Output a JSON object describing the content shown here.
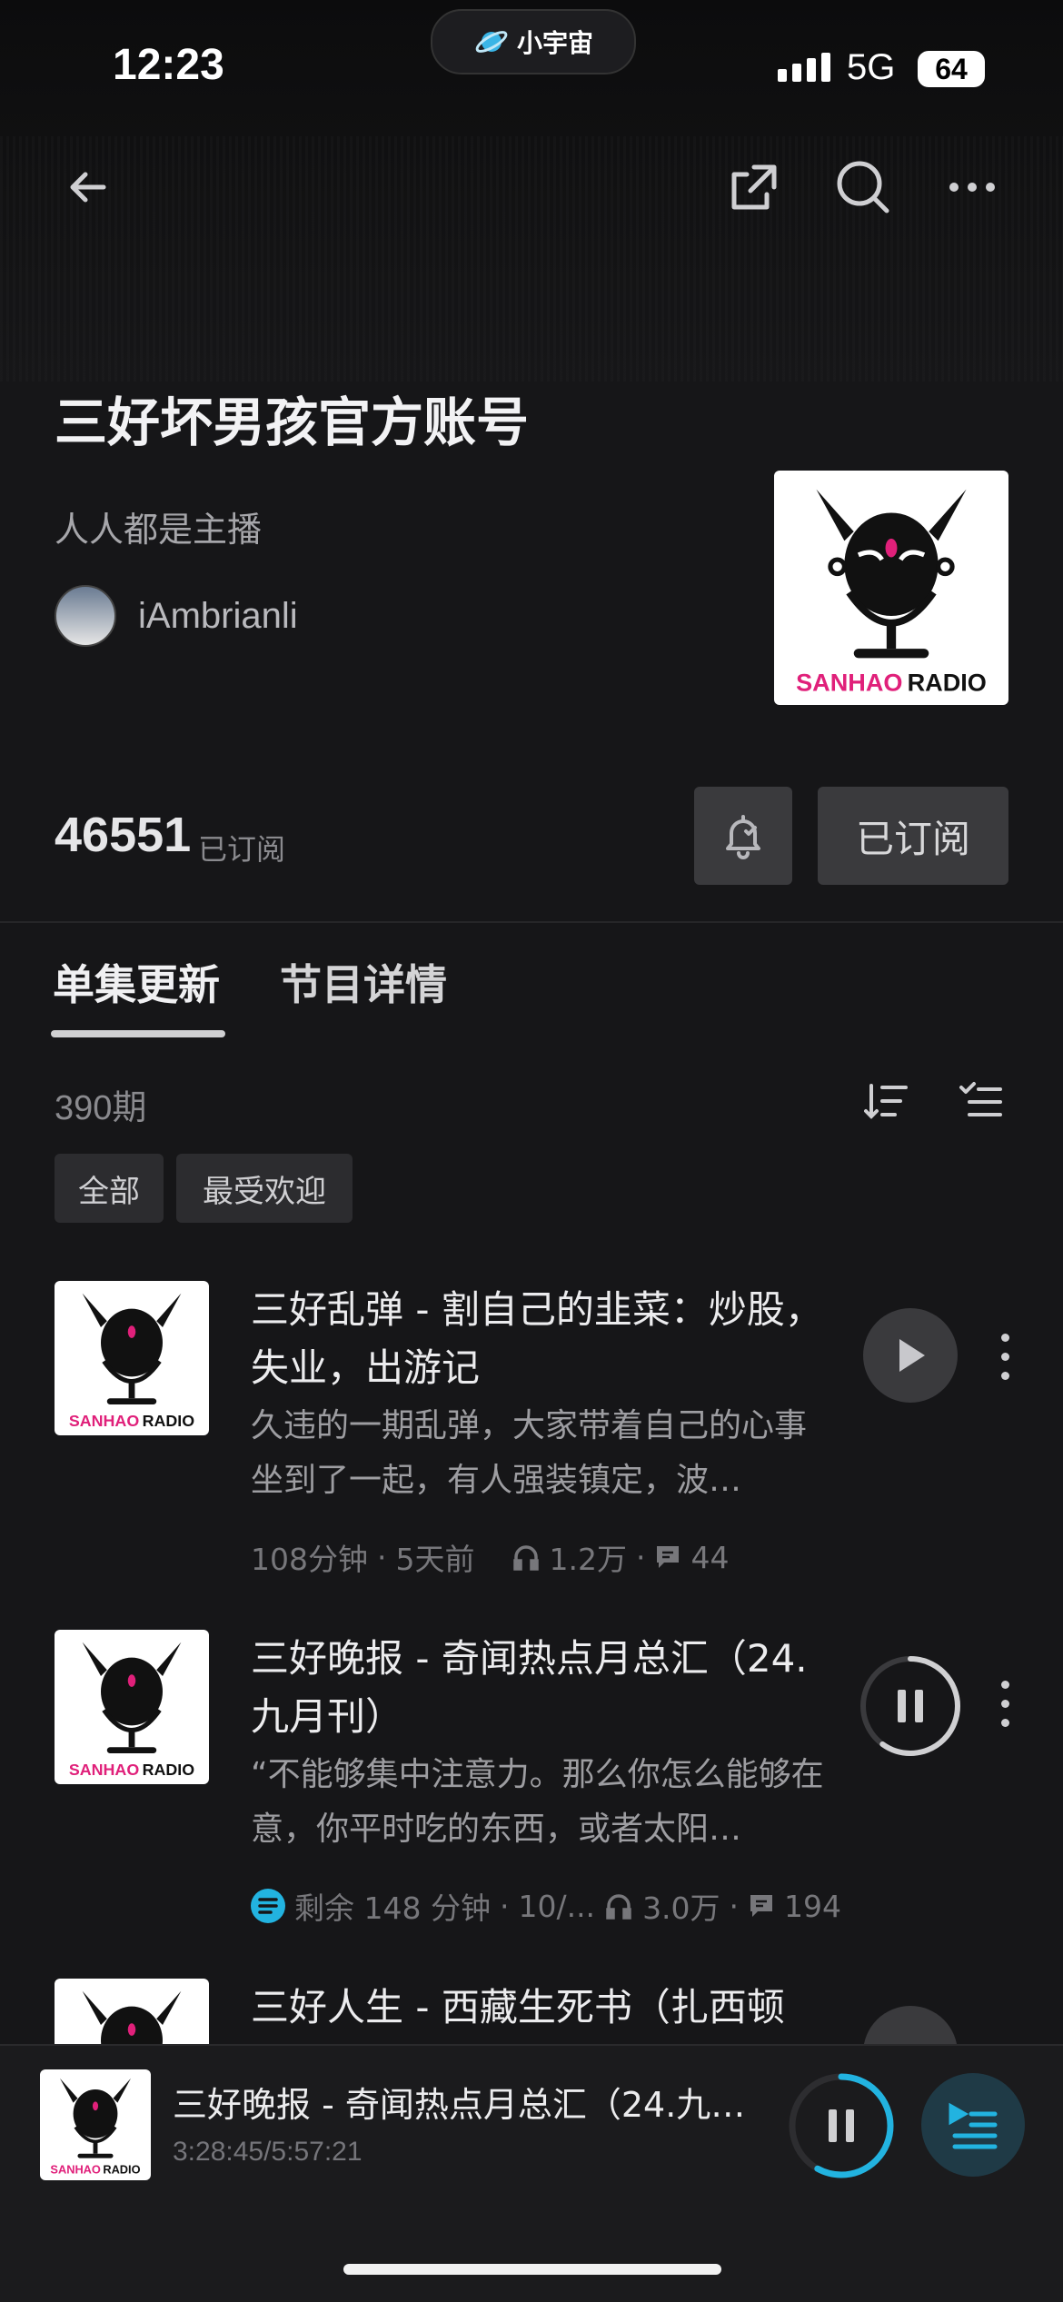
{
  "status_bar": {
    "time": "12:23",
    "island_label": "小宇宙",
    "network": "5G",
    "battery": "64"
  },
  "nav": {
    "back_icon": "arrow-left-icon",
    "share_icon": "share-icon",
    "search_icon": "search-icon",
    "more_icon": "more-horizontal-icon"
  },
  "podcast": {
    "title": "三好坏男孩官方账号",
    "description": "人人都是主播",
    "author": "iAmbrianli",
    "cover_text_a": "SANHAO",
    "cover_text_b": "RADIO",
    "subscriber_count": "46551",
    "subscriber_label": "已订阅",
    "subscribe_button": "已订阅"
  },
  "tabs": [
    {
      "label": "单集更新",
      "active": true
    },
    {
      "label": "节目详情",
      "active": false
    }
  ],
  "episodes_header": {
    "count": "390期"
  },
  "filters": [
    {
      "label": "全部",
      "active": true
    },
    {
      "label": "最受欢迎",
      "active": false
    }
  ],
  "episodes": [
    {
      "title": "三好乱弹 - 割自己的韭菜：炒股，失业，出游记",
      "description": "久违的一期乱弹，大家带着自己的心事坐到了一起，有人强装镇定，波…",
      "duration": "108分钟",
      "date": "5天前",
      "plays": "1.2万",
      "comments": "44",
      "state": "play"
    },
    {
      "title": "三好晚报 - 奇闻热点月总汇（24.九月刊）",
      "description": "“不能够集中注意力。那么你怎么能够在意，你平时吃的东西，或者太阳…",
      "duration": "剩余 148 分钟",
      "date": "10/...",
      "plays": "3.0万",
      "comments": "194",
      "state": "pause",
      "progress": 0.6
    },
    {
      "title": "三好人生 - 西藏生死书（扎西顿",
      "state": "play"
    }
  ],
  "now_playing": {
    "title": "三好晚报 - 奇闻热点月总汇（24.九…",
    "time": "3:28:45/5:57:21",
    "progress": 0.58
  },
  "colors": {
    "accent": "#22b3e0",
    "pink": "#e0207a",
    "background": "#161618"
  }
}
